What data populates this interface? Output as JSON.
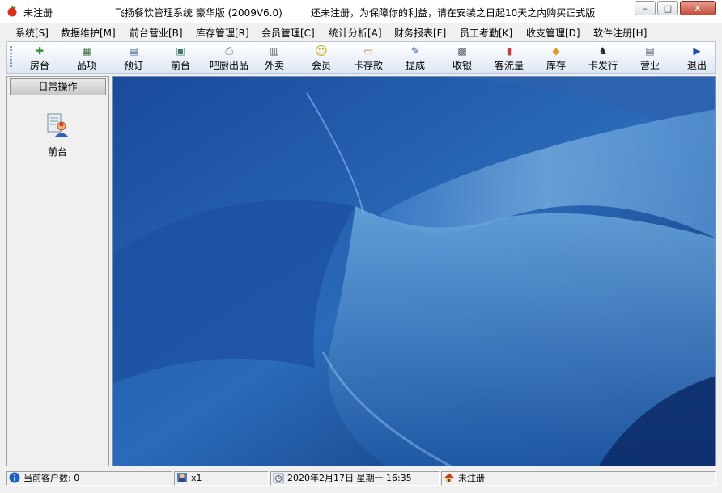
{
  "window": {
    "title": "未注册",
    "app_name": "飞扬餐饮管理系统  豪华版 (2009V6.0)",
    "notice": "还未注册，为保障你的利益，请在安装之日起10天之内购买正式版",
    "buttons": {
      "minimize": "–",
      "maximize": "□",
      "close": "✕"
    }
  },
  "menu": [
    "系统[S]",
    "数据维护[M]",
    "前台营业[B]",
    "库存管理[R]",
    "会员管理[C]",
    "统计分析[A]",
    "财务报表[F]",
    "员工考勤[K]",
    "收支管理[D]",
    "软件注册[H]"
  ],
  "toolbar": [
    {
      "label": "房台",
      "icon": "table-icon",
      "glyph": "✚",
      "color": "#2e8b2e"
    },
    {
      "label": "品项",
      "icon": "items-icon",
      "glyph": "▦",
      "color": "#3a6e3a"
    },
    {
      "label": "预订",
      "icon": "calendar-icon",
      "glyph": "▤",
      "color": "#4a6f8a"
    },
    {
      "label": "前台",
      "icon": "cashier-icon",
      "glyph": "▣",
      "color": "#3d7a6a"
    },
    {
      "label": "吧厨出品",
      "icon": "printer-icon",
      "glyph": "⎙",
      "color": "#667"
    },
    {
      "label": "外卖",
      "icon": "takeout-icon",
      "glyph": "▥",
      "color": "#555"
    },
    {
      "label": "会员",
      "icon": "smiley-icon",
      "glyph": "☺",
      "color": "#c9a400"
    },
    {
      "label": "卡存款",
      "icon": "card-deposit-icon",
      "glyph": "▭",
      "color": "#b07a20"
    },
    {
      "label": "提成",
      "icon": "commission-icon",
      "glyph": "✎",
      "color": "#2a5aa0"
    },
    {
      "label": "收银",
      "icon": "cash-register-icon",
      "glyph": "▩",
      "color": "#556"
    },
    {
      "label": "客流量",
      "icon": "bar-chart-icon",
      "glyph": "▮",
      "color": "#c04040"
    },
    {
      "label": "库存",
      "icon": "box-icon",
      "glyph": "◆",
      "color": "#d89a20"
    },
    {
      "label": "卡发行",
      "icon": "runner-icon",
      "glyph": "♞",
      "color": "#222"
    },
    {
      "label": "营业",
      "icon": "report-icon",
      "glyph": "▤",
      "color": "#667"
    },
    {
      "label": "退出",
      "icon": "exit-door-icon",
      "glyph": "▶",
      "color": "#1f4fa0"
    }
  ],
  "left_panel": {
    "header": "日常操作",
    "shortcut": {
      "label": "前台",
      "icon": "front-desk-user-icon"
    }
  },
  "status": {
    "customers": "当前客户数: 0",
    "scale": "x1",
    "datetime": "2020年2月17日  星期一   16:35",
    "registration": "未注册"
  },
  "colors": {
    "desktop_dark": "#0d2f6e",
    "desktop_light": "#7ab0e0",
    "toolbar_top": "#ffffff",
    "toolbar_bottom": "#dde7f3"
  }
}
